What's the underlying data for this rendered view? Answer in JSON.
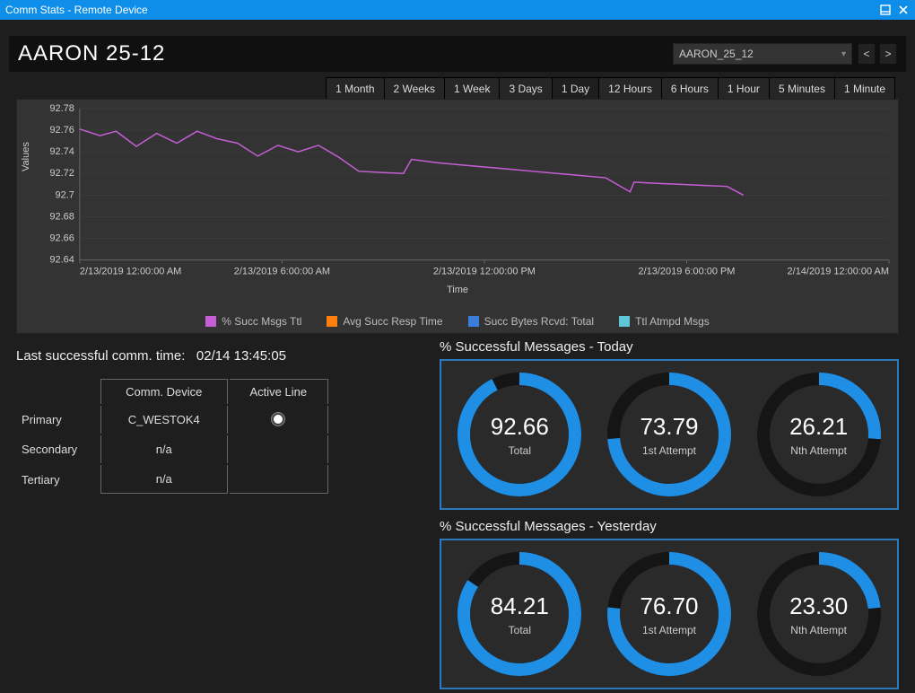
{
  "window": {
    "title": "Comm Stats - Remote Device"
  },
  "header": {
    "device_title": "AARON  25-12",
    "selected_device": "AARON_25_12",
    "range_tabs": [
      "1 Month",
      "2 Weeks",
      "1 Week",
      "3 Days",
      "1 Day",
      "12 Hours",
      "6 Hours",
      "1 Hour",
      "5 Minutes",
      "1 Minute"
    ],
    "selected_range": "1 Day"
  },
  "chart_data": {
    "type": "line",
    "title": "",
    "xlabel": "Time",
    "ylabel": "Values",
    "ylim": [
      92.64,
      92.78
    ],
    "yticks": [
      92.64,
      92.66,
      92.68,
      92.7,
      92.72,
      92.74,
      92.76,
      92.78
    ],
    "xticks": [
      "2/13/2019 12:00:00 AM",
      "2/13/2019 6:00:00 AM",
      "2/13/2019 12:00:00 PM",
      "2/13/2019 6:00:00 PM",
      "2/14/2019 12:00:00 AM"
    ],
    "series": [
      {
        "name": "% Succ Msgs Ttl",
        "color": "#c65fd6",
        "x": [
          0.0,
          0.025,
          0.045,
          0.07,
          0.095,
          0.12,
          0.145,
          0.17,
          0.195,
          0.22,
          0.245,
          0.27,
          0.295,
          0.32,
          0.345,
          0.37,
          0.4,
          0.41,
          0.44,
          0.47,
          0.5,
          0.53,
          0.56,
          0.59,
          0.62,
          0.65,
          0.68,
          0.685,
          0.71,
          0.74,
          0.77,
          0.8,
          0.82
        ],
        "y": [
          92.761,
          92.755,
          92.759,
          92.745,
          92.757,
          92.748,
          92.759,
          92.752,
          92.748,
          92.736,
          92.746,
          92.74,
          92.746,
          92.735,
          92.722,
          92.721,
          92.72,
          92.733,
          92.73,
          92.728,
          92.726,
          92.724,
          92.722,
          92.72,
          92.718,
          92.716,
          92.703,
          92.712,
          92.711,
          92.71,
          92.709,
          92.708,
          92.7
        ]
      },
      {
        "name": "Avg Succ Resp Time",
        "color": "#ff7f0e",
        "x": [],
        "y": []
      },
      {
        "name": "Succ Bytes Rcvd: Total",
        "color": "#3b7dd8",
        "x": [],
        "y": []
      },
      {
        "name": "Ttl Atmpd Msgs",
        "color": "#5fc8d6",
        "x": [],
        "y": []
      }
    ]
  },
  "last_comm": {
    "label": "Last successful comm. time:",
    "value": "02/14 13:45:05"
  },
  "comm_table": {
    "headers": {
      "device": "Comm. Device",
      "active": "Active Line"
    },
    "rows": [
      {
        "role": "Primary",
        "device": "C_WESTOK4",
        "active": true
      },
      {
        "role": "Secondary",
        "device": "n/a",
        "active": false
      },
      {
        "role": "Tertiary",
        "device": "n/a",
        "active": false
      }
    ]
  },
  "gauges": {
    "today": {
      "title": "% Successful Messages - Today",
      "items": [
        {
          "value": "92.66",
          "label": "Total"
        },
        {
          "value": "73.79",
          "label": "1st Attempt"
        },
        {
          "value": "26.21",
          "label": "Nth Attempt"
        }
      ]
    },
    "yesterday": {
      "title": "% Successful Messages - Yesterday",
      "items": [
        {
          "value": "84.21",
          "label": "Total"
        },
        {
          "value": "76.70",
          "label": "1st Attempt"
        },
        {
          "value": "23.30",
          "label": "Nth Attempt"
        }
      ]
    }
  },
  "colors": {
    "accent": "#2a7abf",
    "gauge_fill": "#1f8fe6",
    "gauge_track": "#151515"
  }
}
